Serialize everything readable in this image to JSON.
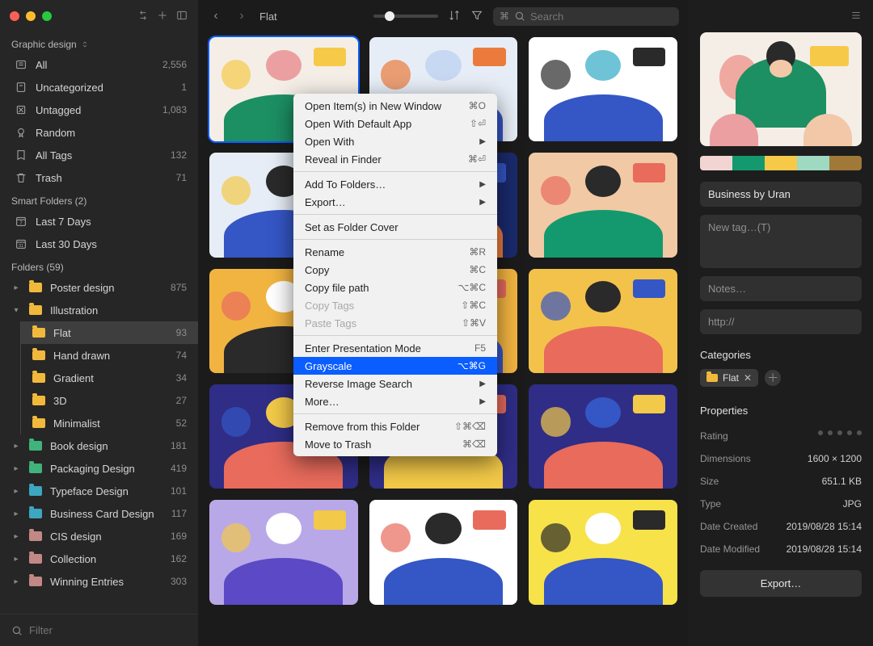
{
  "sidebar": {
    "library_name": "Graphic design",
    "system_items": [
      {
        "label": "All",
        "count": "2,556"
      },
      {
        "label": "Uncategorized",
        "count": "1"
      },
      {
        "label": "Untagged",
        "count": "1,083"
      },
      {
        "label": "Random",
        "count": ""
      },
      {
        "label": "All Tags",
        "count": "132"
      },
      {
        "label": "Trash",
        "count": "71"
      }
    ],
    "smart_header": "Smart Folders (2)",
    "smart_items": [
      {
        "label": "Last 7 Days"
      },
      {
        "label": "Last 30 Days"
      }
    ],
    "folders_header": "Folders (59)",
    "folders": [
      {
        "label": "Poster design",
        "count": "875",
        "color": "#f0b93c",
        "expanded": true
      },
      {
        "label": "Illustration",
        "count": "",
        "color": "#f0b93c",
        "expanded": true,
        "open": true,
        "children": [
          {
            "label": "Flat",
            "count": "93",
            "selected": true
          },
          {
            "label": "Hand drawn",
            "count": "74"
          },
          {
            "label": "Gradient",
            "count": "34"
          },
          {
            "label": "3D",
            "count": "27"
          },
          {
            "label": "Minimalist",
            "count": "52"
          }
        ]
      },
      {
        "label": "Book design",
        "count": "181",
        "color": "#3fb37b"
      },
      {
        "label": "Packaging Design",
        "count": "419",
        "color": "#3fb37b"
      },
      {
        "label": "Typeface Design",
        "count": "101",
        "color": "#3da6c1"
      },
      {
        "label": "Business Card Design",
        "count": "117",
        "color": "#3da6c1"
      },
      {
        "label": "CIS design",
        "count": "169",
        "color": "#c18886"
      },
      {
        "label": "Collection",
        "count": "162",
        "color": "#c18886"
      },
      {
        "label": "Winning Entries",
        "count": "303",
        "color": "#c18886"
      }
    ],
    "filter_placeholder": "Filter"
  },
  "main": {
    "breadcrumb": "Flat",
    "search": {
      "prefix": "⌘",
      "placeholder": "Search"
    }
  },
  "context_menu": {
    "groups": [
      [
        {
          "label": "Open Item(s) in New Window",
          "shortcut": "⌘O"
        },
        {
          "label": "Open With Default App",
          "shortcut": "⇧⏎"
        },
        {
          "label": "Open With",
          "submenu": true
        },
        {
          "label": "Reveal in Finder",
          "shortcut": "⌘⏎"
        }
      ],
      [
        {
          "label": "Add To Folders…",
          "submenu": true
        },
        {
          "label": "Export…",
          "submenu": true
        }
      ],
      [
        {
          "label": "Set as Folder Cover"
        }
      ],
      [
        {
          "label": "Rename",
          "shortcut": "⌘R"
        },
        {
          "label": "Copy",
          "shortcut": "⌘C"
        },
        {
          "label": "Copy file path",
          "shortcut": "⌥⌘C"
        },
        {
          "label": "Copy Tags",
          "shortcut": "⇧⌘C",
          "disabled": true
        },
        {
          "label": "Paste Tags",
          "shortcut": "⇧⌘V",
          "disabled": true
        }
      ],
      [
        {
          "label": "Enter Presentation Mode",
          "shortcut": "F5"
        },
        {
          "label": "Grayscale",
          "shortcut": "⌥⌘G",
          "selected": true
        },
        {
          "label": "Reverse Image Search",
          "submenu": true
        },
        {
          "label": "More…",
          "submenu": true
        }
      ],
      [
        {
          "label": "Remove from this Folder",
          "shortcut": "⇧⌘⌫"
        },
        {
          "label": "Move to Trash",
          "shortcut": "⌘⌫"
        }
      ]
    ]
  },
  "inspector": {
    "title": "Business by Uran",
    "swatches": [
      "#f2d5d3",
      "#14996e",
      "#f7c948",
      "#9ed9c2",
      "#a07838"
    ],
    "tag_placeholder": "New tag…(T)",
    "notes_placeholder": "Notes…",
    "url_placeholder": "http://",
    "categories_title": "Categories",
    "category_chip": "Flat",
    "properties_title": "Properties",
    "props": {
      "rating_label": "Rating",
      "dimensions_label": "Dimensions",
      "dimensions_value": "1600 × 1200",
      "size_label": "Size",
      "size_value": "651.1 KB",
      "type_label": "Type",
      "type_value": "JPG",
      "created_label": "Date Created",
      "created_value": "2019/08/28 15:14",
      "modified_label": "Date Modified",
      "modified_value": "2019/08/28 15:14"
    },
    "export_label": "Export…"
  }
}
